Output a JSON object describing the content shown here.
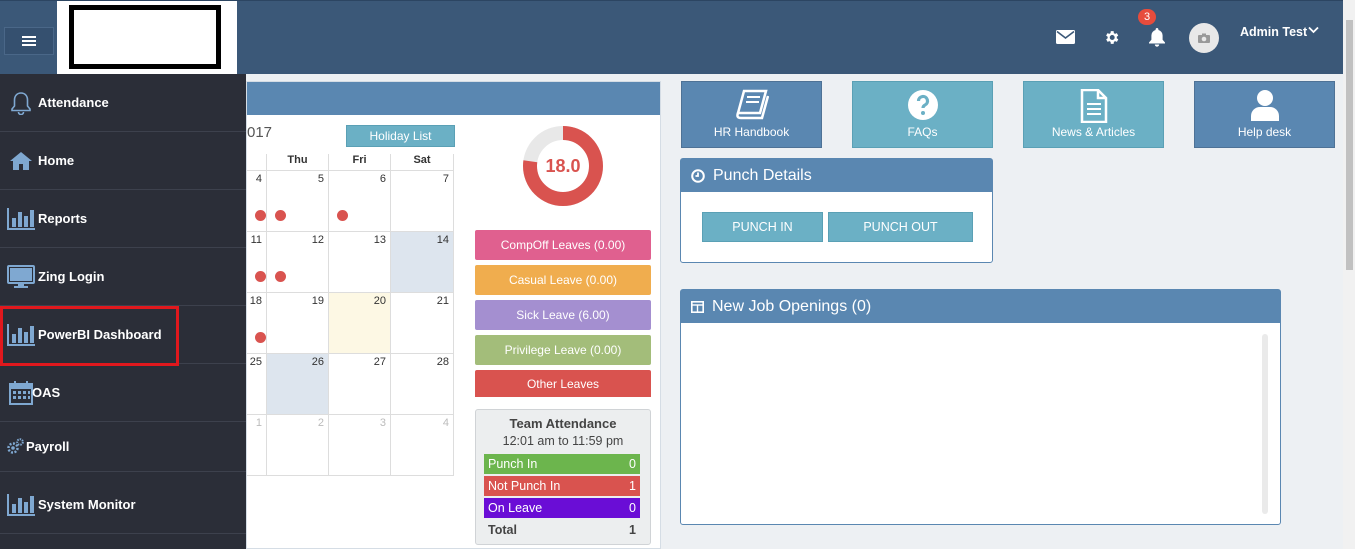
{
  "header": {
    "notification_count": "3",
    "user_name": "Admin Test",
    "avatar_text": "no photo"
  },
  "sidebar": {
    "items": [
      {
        "label": "Attendance",
        "icon": "bell-icon"
      },
      {
        "label": "Home",
        "icon": "home-icon"
      },
      {
        "label": "Reports",
        "icon": "bar-chart-icon"
      },
      {
        "label": "Zing Login",
        "icon": "monitor-icon"
      },
      {
        "label": "PowerBI Dashboard",
        "icon": "bar-chart-icon"
      },
      {
        "label": "OAS",
        "icon": "calendar-icon"
      },
      {
        "label": "Payroll",
        "icon": "cogs-icon"
      },
      {
        "label": "System Monitor",
        "icon": "bar-chart-icon"
      }
    ],
    "highlighted": "PowerBI Dashboard",
    "highlight_color": "#e0181d"
  },
  "calendar": {
    "year_text": "017",
    "holiday_button": "Holiday List",
    "day_names": [
      "Thu",
      "Fri",
      "Sat"
    ],
    "rows": [
      {
        "cells": [
          "4",
          "5",
          "6",
          "7"
        ],
        "dots": [
          true,
          true,
          true,
          false
        ]
      },
      {
        "cells": [
          "11",
          "12",
          "13",
          "14"
        ],
        "dots": [
          true,
          true,
          false,
          false
        ]
      },
      {
        "cells": [
          "18",
          "19",
          "20",
          "21"
        ],
        "dots": [
          true,
          false,
          false,
          false
        ]
      },
      {
        "cells": [
          "25",
          "26",
          "27",
          "28"
        ],
        "dots": [
          false,
          false,
          false,
          false
        ]
      },
      {
        "cells": [
          "1",
          "2",
          "3",
          "4"
        ],
        "dots": [
          false,
          false,
          false,
          false
        ]
      }
    ]
  },
  "leaves": {
    "balance": "18.0",
    "buttons": [
      {
        "label": "CompOff Leaves (0.00)",
        "color": "#e0608f"
      },
      {
        "label": "Casual Leave (0.00)",
        "color": "#f0ad4e"
      },
      {
        "label": "Sick Leave (6.00)",
        "color": "#a48fd0"
      },
      {
        "label": "Privilege Leave (0.00)",
        "color": "#a3bd7a"
      },
      {
        "label": "Other Leaves",
        "color": "#d9534f"
      }
    ]
  },
  "team_attendance": {
    "title": "Team Attendance",
    "time_range": "12:01 am to 11:59 pm",
    "rows": [
      {
        "label": "Punch In",
        "value": "0",
        "color": "#6cb54d"
      },
      {
        "label": "Not Punch In",
        "value": "1",
        "color": "#d9534f"
      },
      {
        "label": "On Leave",
        "value": "0",
        "color": "#6a0dd6"
      },
      {
        "label": "Total",
        "value": "1",
        "color": ""
      }
    ]
  },
  "tiles": [
    {
      "label": "HR Handbook",
      "icon": "book-icon",
      "color": "#5a87b1"
    },
    {
      "label": "FAQs",
      "icon": "question-icon",
      "color": "#6bb0c5"
    },
    {
      "label": "News & Articles",
      "icon": "document-icon",
      "color": "#6bb0c5"
    },
    {
      "label": "Help desk",
      "icon": "user-icon",
      "color": "#5a87b1"
    }
  ],
  "punch": {
    "title": "Punch Details",
    "punch_in": "PUNCH IN",
    "punch_out": "PUNCH OUT"
  },
  "jobs": {
    "title": "New Job Openings (0)"
  }
}
